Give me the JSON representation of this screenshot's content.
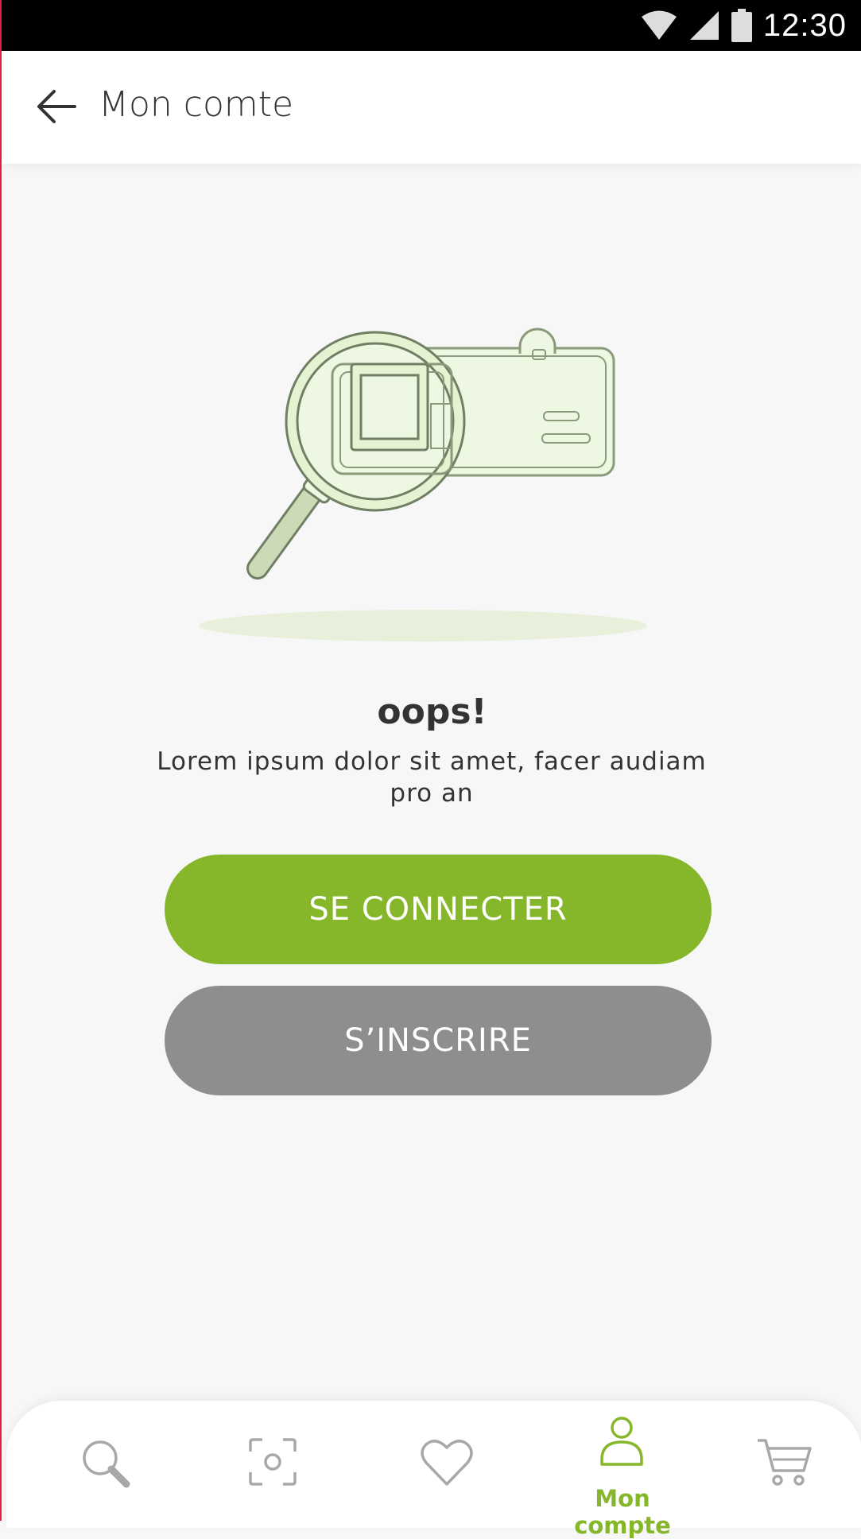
{
  "status_bar": {
    "time": "12:30",
    "icons": [
      "wifi-icon",
      "signal-icon",
      "battery-icon"
    ]
  },
  "app_bar": {
    "title": "Mon comte",
    "back_icon": "arrow-left-icon"
  },
  "empty_state": {
    "illustration": "magnifier-id-card-illustration",
    "title": "oops!",
    "description": "Lorem ipsum dolor sit amet, facer audiam pro an"
  },
  "buttons": {
    "connect_label": "SE CONNECTER",
    "register_label": "S’INSCRIRE"
  },
  "bottom_nav": {
    "items": [
      {
        "icon": "search-icon",
        "label": ""
      },
      {
        "icon": "scan-icon",
        "label": ""
      },
      {
        "icon": "heart-icon",
        "label": ""
      },
      {
        "icon": "user-icon",
        "label": "Mon compte",
        "active": true
      },
      {
        "icon": "cart-icon",
        "label": ""
      }
    ]
  },
  "colors": {
    "accent": "#86b72a",
    "secondary_button": "#8e8e8e",
    "background": "#f7f7f7",
    "text": "#333333"
  }
}
